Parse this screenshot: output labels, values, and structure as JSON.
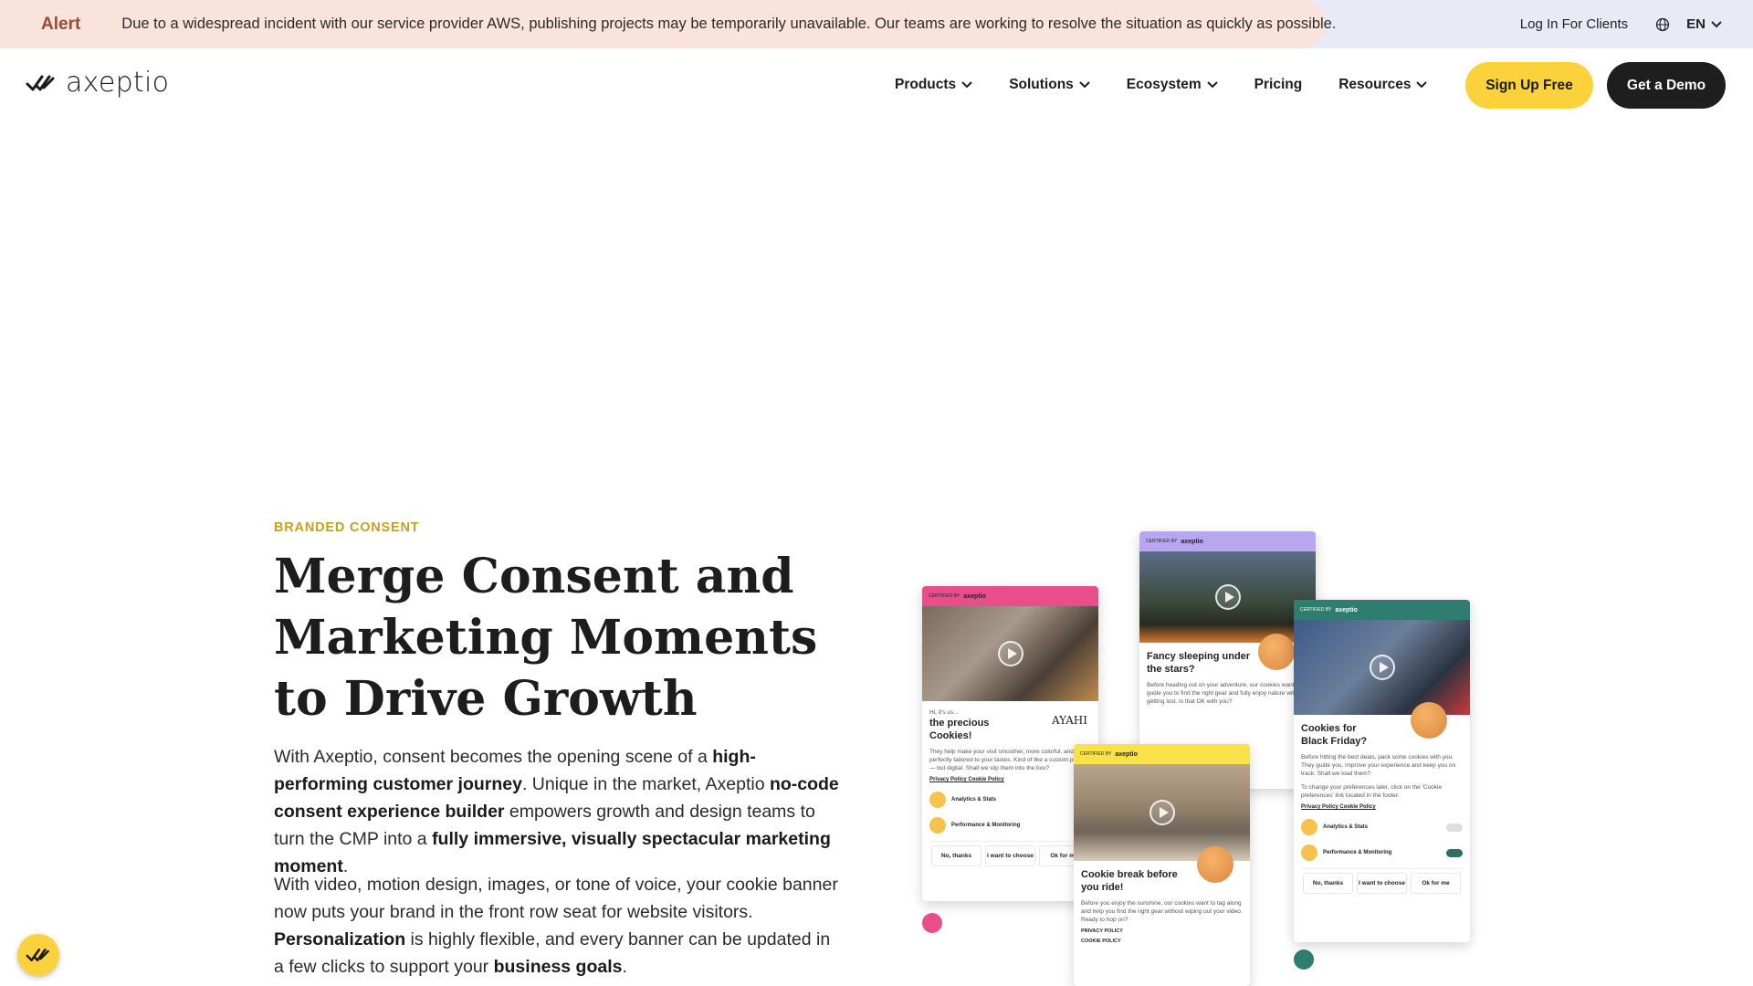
{
  "alert": {
    "title": "Alert",
    "message": "Due to a widespread incident with our service provider AWS, publishing projects may be temporarily unavailable. Our teams are working to resolve the situation as quickly as possible."
  },
  "topbar": {
    "login_label": "Log In For Clients",
    "language": "EN"
  },
  "brand": {
    "name": "axeptio"
  },
  "nav": {
    "items": [
      {
        "label": "Products",
        "has_dropdown": true
      },
      {
        "label": "Solutions",
        "has_dropdown": true
      },
      {
        "label": "Ecosystem",
        "has_dropdown": true
      },
      {
        "label": "Pricing",
        "has_dropdown": false
      },
      {
        "label": "Resources",
        "has_dropdown": true
      }
    ],
    "signup_label": "Sign Up Free",
    "demo_label": "Get a Demo"
  },
  "hero": {
    "eyebrow": "BRANDED CONSENT",
    "headline": "Merge Consent and Marketing Moments to Drive Growth",
    "p1": {
      "t1": "With Axeptio, consent becomes the opening scene of a ",
      "b1": "high-performing customer journey",
      "t2": ". Unique in the market, Axeptio ",
      "b2": "no-code consent experience builder",
      "t3": " empowers growth and design teams to turn the CMP into a ",
      "b3": "fully immersive, visually spectacular marketing moment",
      "t4": "."
    },
    "p2": {
      "t1": "With video, motion design, images, or tone of voice, your cookie banner now puts your brand in the front row seat for website visitors. ",
      "b1": "Personalization",
      "t2": " is highly flexible, and every banner can be updated in a few clicks to support your ",
      "b2": "business goals",
      "t3": "."
    }
  },
  "illustration": {
    "card_pink": {
      "intro": "Hi, it's us...",
      "title": "the precious Cookies!",
      "brand": "AYAHI",
      "text": "They help make your visit smoother, more colorful, and perfectly tailored to your tastes. Kind of like a custom piece — but digital. Shall we slip them into the box?",
      "links": "Privacy Policy   Cookie Policy",
      "row1": "Analytics & Stats",
      "row2": "Performance & Monitoring",
      "buttons": [
        "No, thanks",
        "I want to choose",
        "Ok for me"
      ]
    },
    "card_purple": {
      "title": "Fancy sleeping under the stars?",
      "text": "Before heading out on your adventure, our cookies want to guide you to find the right gear and fully enjoy nature without getting lost. Is that OK with you?"
    },
    "card_green": {
      "title": "Cookies for Black Friday?",
      "text": "Before hitting the best deals, pack some cookies with you. They guide you, improve your experience and keep you on track. Shall we load them?",
      "text2": "To change your preferences later, click on the 'Cookie preferences' link located in the footer.",
      "links": "Privacy Policy   Cookie Policy",
      "row1": "Analytics & Stats",
      "row2": "Performance & Monitoring",
      "buttons": [
        "No, thanks",
        "I want to choose",
        "Ok for me"
      ]
    },
    "card_yellow": {
      "title": "Cookie break before you ride!",
      "text": "Before you enjoy the sunshine, our cookies want to tag along and help you find the right gear without wiping out your video. Ready to hop on?",
      "link1": "PRIVACY POLICY",
      "link2": "COOKIE POLICY"
    },
    "certified": "CERTIFIED BY",
    "mini_brand": "axeptio"
  },
  "colors": {
    "alert_bg": "#f9e3da",
    "accent_yellow": "#fcd23c",
    "eyebrow": "#c8a020",
    "pink": "#e84e8a",
    "purple": "#b9a6f0",
    "green": "#2f7d6e",
    "yellow": "#f9e14a"
  }
}
